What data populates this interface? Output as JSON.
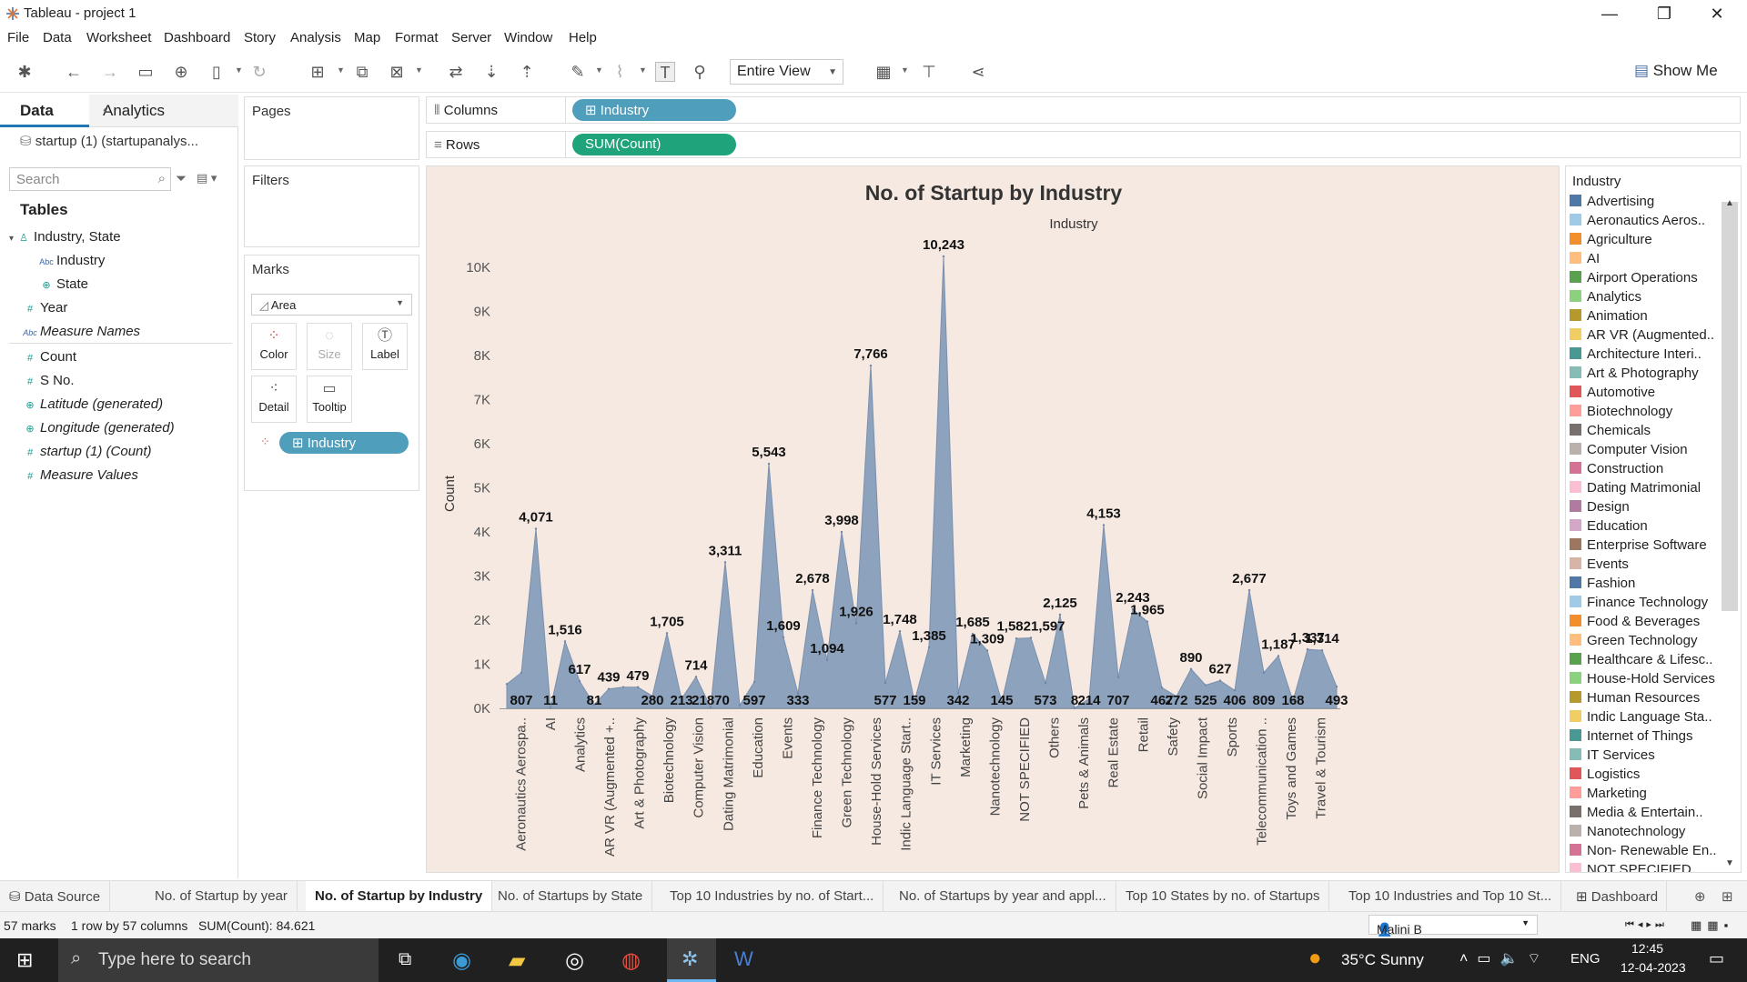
{
  "window": {
    "title": "Tableau - project 1",
    "minimize": "—",
    "maximize": "❐",
    "close": "✕"
  },
  "menu": [
    "File",
    "Data",
    "Worksheet",
    "Dashboard",
    "Story",
    "Analysis",
    "Map",
    "Format",
    "Server",
    "Window",
    "Help"
  ],
  "toolbar": {
    "fit": "Entire View",
    "show_me": "Show Me"
  },
  "left": {
    "tab_data": "Data",
    "tab_analytics": "Analytics",
    "datasource": "startup (1) (startupanalys...",
    "search_placeholder": "Search",
    "tables_header": "Tables",
    "fields": [
      {
        "label": "Industry, State",
        "icon": "hierarchy-icon"
      },
      {
        "label": "Industry",
        "icon": "abc-icon"
      },
      {
        "label": "State",
        "icon": "globe-icon"
      },
      {
        "label": "Year",
        "icon": "hash-icon"
      },
      {
        "label": "Measure Names",
        "icon": "abc-icon"
      },
      {
        "label": "Count",
        "icon": "hash-icon"
      },
      {
        "label": "S No.",
        "icon": "hash-icon"
      },
      {
        "label": "Latitude (generated)",
        "icon": "globe-icon"
      },
      {
        "label": "Longitude (generated)",
        "icon": "globe-icon"
      },
      {
        "label": "startup (1) (Count)",
        "icon": "hash-icon"
      },
      {
        "label": "Measure Values",
        "icon": "hash-icon"
      }
    ]
  },
  "cards": {
    "pages": "Pages",
    "filters": "Filters",
    "marks": "Marks",
    "mark_type": "Area",
    "mark_buttons": [
      "Color",
      "Size",
      "Label",
      "Detail",
      "Tooltip"
    ],
    "marks_pill": "Industry"
  },
  "shelves": {
    "columns_label": "Columns",
    "columns_pill": "Industry",
    "rows_label": "Rows",
    "rows_pill": "SUM(Count)"
  },
  "chart_data": {
    "type": "area",
    "title": "No. of Startup by Industry",
    "header": "Industry",
    "ylabel": "Count",
    "ylim": [
      0,
      10243
    ],
    "yticks": [
      "0K",
      "1K",
      "2K",
      "3K",
      "4K",
      "5K",
      "6K",
      "7K",
      "8K",
      "9K",
      "10K"
    ],
    "x_labels": [
      "Aeronautics Aerospa..",
      "AI",
      "Analytics",
      "AR VR (Augmented +..",
      "Art & Photography",
      "Biotechnology",
      "Computer Vision",
      "Dating Matrimonial",
      "Education",
      "Events",
      "Finance Technology",
      "Green Technology",
      "House-Hold Services",
      "Indic Language Start..",
      "IT Services",
      "Marketing",
      "Nanotechnology",
      "NOT SPECIFIED",
      "Others",
      "Pets & Animals",
      "Real Estate",
      "Retail",
      "Safety",
      "Social Impact",
      "Sports",
      "Telecommunication ..",
      "Toys and Games",
      "Travel & Tourism"
    ],
    "values": [
      549,
      807,
      4071,
      11,
      1516,
      617,
      81,
      439,
      479,
      479,
      280,
      1705,
      213,
      714,
      21,
      3311,
      70,
      597,
      5543,
      1609,
      333,
      2678,
      1094,
      3998,
      1926,
      7766,
      577,
      1748,
      159,
      1385,
      10243,
      342,
      1685,
      1309,
      145,
      1582,
      1597,
      573,
      2125,
      8,
      214,
      4153,
      707,
      2243,
      1965,
      467,
      272,
      890,
      525,
      627,
      406,
      2677,
      809,
      1187,
      168,
      1337,
      1314,
      493
    ],
    "labels": [
      {
        "i": 1,
        "t": "807",
        "pos": "low"
      },
      {
        "i": 2,
        "t": "4,071",
        "pos": "high"
      },
      {
        "i": 3,
        "t": "11",
        "pos": "low"
      },
      {
        "i": 4,
        "t": "1,516",
        "pos": "high"
      },
      {
        "i": 5,
        "t": "617",
        "pos": "high"
      },
      {
        "i": 6,
        "t": "81",
        "pos": "low"
      },
      {
        "i": 7,
        "t": "439",
        "pos": "high"
      },
      {
        "i": 9,
        "t": "479",
        "pos": "high"
      },
      {
        "i": 10,
        "t": "280",
        "pos": "low"
      },
      {
        "i": 11,
        "t": "1,705",
        "pos": "high"
      },
      {
        "i": 12,
        "t": "213",
        "pos": "low"
      },
      {
        "i": 13,
        "t": "714",
        "pos": "high"
      },
      {
        "i": 14,
        "t": "21870",
        "pos": "low"
      },
      {
        "i": 15,
        "t": "3,311",
        "pos": "high"
      },
      {
        "i": 17,
        "t": "597",
        "pos": "low"
      },
      {
        "i": 18,
        "t": "5,543",
        "pos": "high"
      },
      {
        "i": 19,
        "t": "1,609",
        "pos": "high"
      },
      {
        "i": 20,
        "t": "333",
        "pos": "low"
      },
      {
        "i": 21,
        "t": "2,678",
        "pos": "high"
      },
      {
        "i": 22,
        "t": "1,094",
        "pos": "high"
      },
      {
        "i": 23,
        "t": "3,998",
        "pos": "high"
      },
      {
        "i": 24,
        "t": "1,926",
        "pos": "high"
      },
      {
        "i": 25,
        "t": "7,766",
        "pos": "high"
      },
      {
        "i": 26,
        "t": "577",
        "pos": "low"
      },
      {
        "i": 27,
        "t": "1,748",
        "pos": "high"
      },
      {
        "i": 28,
        "t": "159",
        "pos": "low"
      },
      {
        "i": 29,
        "t": "1,385",
        "pos": "high"
      },
      {
        "i": 30,
        "t": "10,243",
        "pos": "high"
      },
      {
        "i": 31,
        "t": "342",
        "pos": "low"
      },
      {
        "i": 32,
        "t": "1,685",
        "pos": "high"
      },
      {
        "i": 33,
        "t": "1,309",
        "pos": "high"
      },
      {
        "i": 34,
        "t": "145",
        "pos": "low"
      },
      {
        "i": 36,
        "t": "1,5821,597",
        "pos": "high"
      },
      {
        "i": 37,
        "t": "573",
        "pos": "low"
      },
      {
        "i": 38,
        "t": "2,125",
        "pos": "high"
      },
      {
        "i": 39,
        "t": "8",
        "pos": "low"
      },
      {
        "i": 40,
        "t": "214",
        "pos": "low"
      },
      {
        "i": 41,
        "t": "4,153",
        "pos": "high"
      },
      {
        "i": 42,
        "t": "707",
        "pos": "low"
      },
      {
        "i": 43,
        "t": "2,243",
        "pos": "high"
      },
      {
        "i": 44,
        "t": "1,965",
        "pos": "high"
      },
      {
        "i": 45,
        "t": "467",
        "pos": "low"
      },
      {
        "i": 46,
        "t": "272",
        "pos": "low"
      },
      {
        "i": 47,
        "t": "890",
        "pos": "high"
      },
      {
        "i": 48,
        "t": "525",
        "pos": "low"
      },
      {
        "i": 49,
        "t": "627",
        "pos": "high"
      },
      {
        "i": 50,
        "t": "406",
        "pos": "low"
      },
      {
        "i": 51,
        "t": "2,677",
        "pos": "high"
      },
      {
        "i": 52,
        "t": "809",
        "pos": "low"
      },
      {
        "i": 53,
        "t": "1,187",
        "pos": "high"
      },
      {
        "i": 54,
        "t": "168",
        "pos": "low"
      },
      {
        "i": 55,
        "t": "1,337",
        "pos": "high"
      },
      {
        "i": 56,
        "t": "1,314",
        "pos": "high"
      },
      {
        "i": 57,
        "t": "493",
        "pos": "low"
      }
    ],
    "fill_color": "#8da2bd"
  },
  "legend": {
    "title": "Industry",
    "items": [
      {
        "label": "Advertising",
        "color": "#4e79a7"
      },
      {
        "label": "Aeronautics Aeros..",
        "color": "#a0cbe8"
      },
      {
        "label": "Agriculture",
        "color": "#f28e2b"
      },
      {
        "label": "AI",
        "color": "#ffbe7d"
      },
      {
        "label": "Airport Operations",
        "color": "#59a14f"
      },
      {
        "label": "Analytics",
        "color": "#8cd17d"
      },
      {
        "label": "Animation",
        "color": "#b6992d"
      },
      {
        "label": "AR VR (Augmented..",
        "color": "#f1ce63"
      },
      {
        "label": "Architecture Interi..",
        "color": "#499894"
      },
      {
        "label": "Art & Photography",
        "color": "#86bcb6"
      },
      {
        "label": "Automotive",
        "color": "#e15759"
      },
      {
        "label": "Biotechnology",
        "color": "#ff9d9a"
      },
      {
        "label": "Chemicals",
        "color": "#79706e"
      },
      {
        "label": "Computer Vision",
        "color": "#bab0ac"
      },
      {
        "label": "Construction",
        "color": "#d37295"
      },
      {
        "label": "Dating Matrimonial",
        "color": "#fabfd2"
      },
      {
        "label": "Design",
        "color": "#b07aa1"
      },
      {
        "label": "Education",
        "color": "#d4a6c8"
      },
      {
        "label": "Enterprise Software",
        "color": "#9d7660"
      },
      {
        "label": "Events",
        "color": "#d7b5a6"
      },
      {
        "label": "Fashion",
        "color": "#4e79a7"
      },
      {
        "label": "Finance Technology",
        "color": "#a0cbe8"
      },
      {
        "label": "Food & Beverages",
        "color": "#f28e2b"
      },
      {
        "label": "Green Technology",
        "color": "#ffbe7d"
      },
      {
        "label": "Healthcare & Lifesc..",
        "color": "#59a14f"
      },
      {
        "label": "House-Hold Services",
        "color": "#8cd17d"
      },
      {
        "label": "Human Resources",
        "color": "#b6992d"
      },
      {
        "label": "Indic Language Sta..",
        "color": "#f1ce63"
      },
      {
        "label": "Internet of Things",
        "color": "#499894"
      },
      {
        "label": "IT Services",
        "color": "#86bcb6"
      },
      {
        "label": "Logistics",
        "color": "#e15759"
      },
      {
        "label": "Marketing",
        "color": "#ff9d9a"
      },
      {
        "label": "Media & Entertain..",
        "color": "#79706e"
      },
      {
        "label": "Nanotechnology",
        "color": "#bab0ac"
      },
      {
        "label": "Non- Renewable En..",
        "color": "#d37295"
      },
      {
        "label": "NOT SPECIFIED",
        "color": "#fabfd2"
      }
    ]
  },
  "sheet_tabs": [
    "Data Source",
    "No. of Startup by year",
    "No. of Startup by Industry",
    "No. of Startups by State",
    "Top 10 Industries by no. of Start...",
    "No. of Startups by year and appl...",
    "Top 10 States by no. of Startups",
    "Top 10 Industries and Top 10 St...",
    "Dashboard"
  ],
  "status": {
    "marks": "57 marks",
    "rows": "1 row by 57 columns",
    "sum": "SUM(Count): 84.621",
    "user": "Malini B"
  },
  "taskbar": {
    "search": "Type here to search",
    "weather": "35°C  Sunny",
    "lang": "ENG",
    "time": "12:45",
    "date": "12-04-2023"
  }
}
